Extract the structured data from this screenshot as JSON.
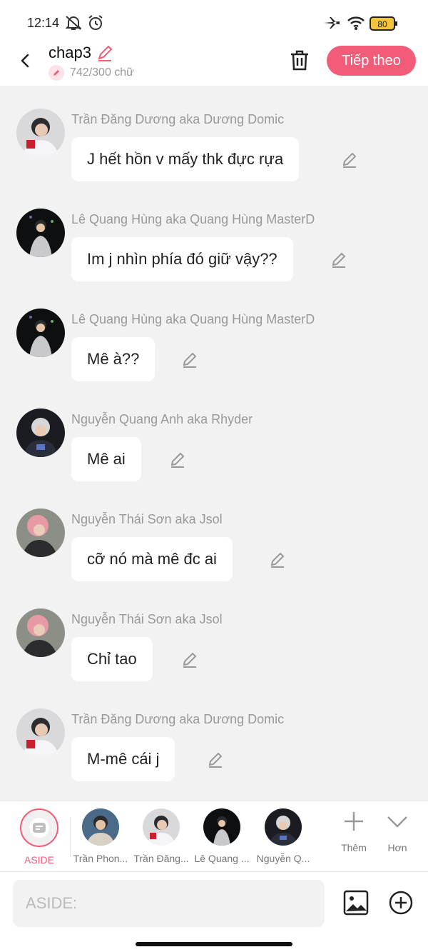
{
  "status_bar": {
    "time": "12:14",
    "battery": "80",
    "icons": [
      "mute-icon",
      "alarm-icon",
      "airplane-icon",
      "wifi-icon",
      "battery-icon"
    ]
  },
  "header": {
    "title": "chap3",
    "word_count": "742/300 chữ",
    "next_label": "Tiếp theo",
    "accent_color": "#f25c78"
  },
  "messages": [
    {
      "name": "Trần Đăng Dương aka Dương Domic",
      "text": "J hết hồn v mấy thk đực rựa",
      "avatar": "tdd"
    },
    {
      "name": "Lê Quang Hùng aka Quang Hùng MasterD",
      "text": "Im j nhìn phía đó giữ vậy??",
      "avatar": "lqh"
    },
    {
      "name": "Lê Quang Hùng aka Quang Hùng MasterD",
      "text": "Mê à??",
      "avatar": "lqh"
    },
    {
      "name": "Nguyễn Quang Anh aka Rhyder",
      "text": "Mê ai",
      "avatar": "nqa"
    },
    {
      "name": "Nguyễn Thái Sơn aka Jsol",
      "text": "cỡ nó mà mê đc ai",
      "avatar": "nts"
    },
    {
      "name": "Nguyễn Thái Sơn aka Jsol",
      "text": "Chỉ tao",
      "avatar": "nts"
    },
    {
      "name": "Trần Đăng Dương aka Dương Domic",
      "text": "M-mê cái j",
      "avatar": "tdd"
    }
  ],
  "characters": [
    {
      "label": "ASIDE"
    },
    {
      "label": "Trần Phon..."
    },
    {
      "label": "Trần Đăng..."
    },
    {
      "label": "Lê Quang ..."
    },
    {
      "label": "Nguyễn Q..."
    }
  ],
  "tools": {
    "more_label": "Thêm",
    "less_label": "Hơn"
  },
  "input": {
    "placeholder": "ASIDE:"
  }
}
